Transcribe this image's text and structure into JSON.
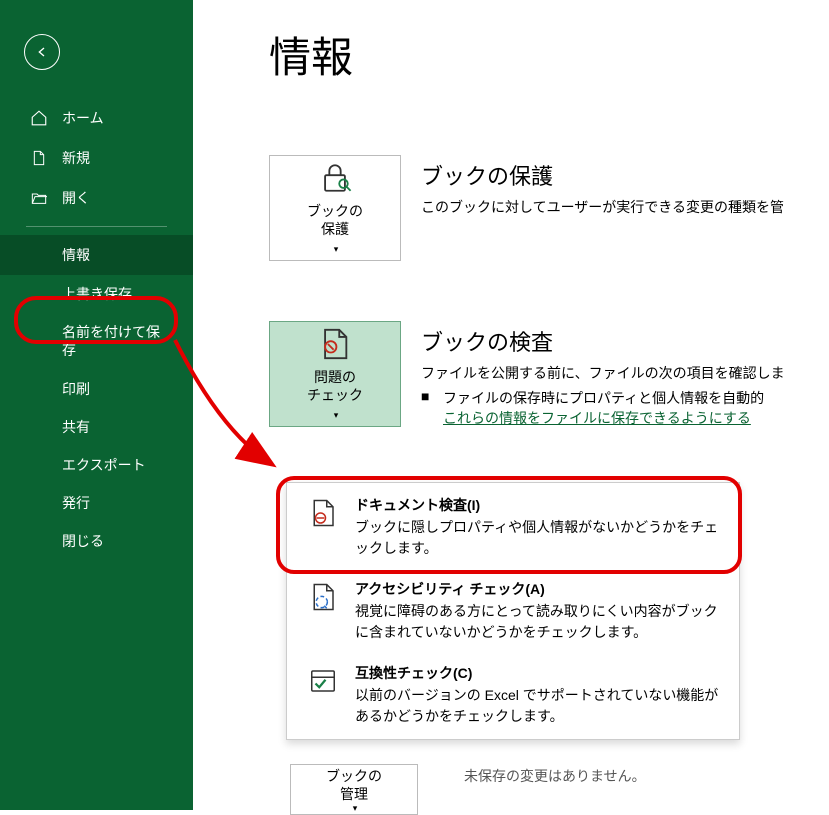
{
  "sidebar": {
    "items": [
      {
        "label": "ホーム",
        "icon": "home"
      },
      {
        "label": "新規",
        "icon": "document-new"
      },
      {
        "label": "開く",
        "icon": "folder-open"
      }
    ],
    "selected": "情報",
    "sub_items": [
      "上書き保存",
      "名前を付けて保存",
      "印刷",
      "共有",
      "エクスポート",
      "発行",
      "閉じる"
    ]
  },
  "page": {
    "title": "情報"
  },
  "sections": {
    "protect": {
      "tile_label": "ブックの\n保護",
      "title": "ブックの保護",
      "desc": "このブックに対してユーザーが実行できる変更の種類を管"
    },
    "inspect": {
      "tile_label": "問題の\nチェック",
      "title": "ブックの検査",
      "desc": "ファイルを公開する前に、ファイルの次の項目を確認しま",
      "bullet": "ファイルの保存時にプロパティと個人情報を自動的",
      "link": "これらの情報をファイルに保存できるようにする"
    },
    "manage": {
      "tile_label": "ブックの\n管理",
      "cut_text": "未保存の変更はありません。"
    }
  },
  "dropdown": {
    "doc_inspect": {
      "title": "ドキュメント検査(I)",
      "desc": "ブックに隠しプロパティや個人情報がないかどうかをチェックします。"
    },
    "accessibility": {
      "title": "アクセシビリティ チェック(A)",
      "desc": "視覚に障碍のある方にとって読み取りにくい内容がブックに含まれていないかどうかをチェックします。"
    },
    "compat": {
      "title": "互換性チェック(C)",
      "desc": "以前のバージョンの Excel でサポートされていない機能があるかどうかをチェックします。"
    }
  }
}
